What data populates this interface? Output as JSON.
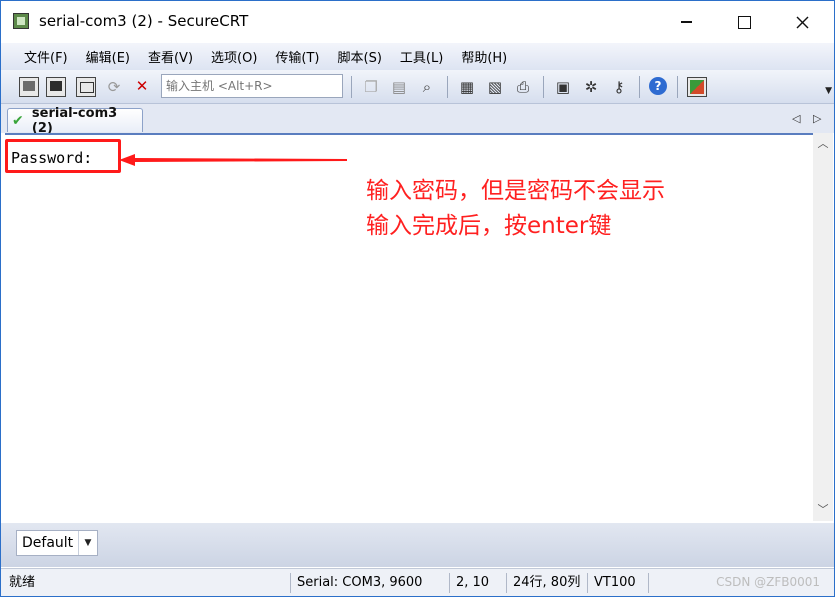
{
  "window": {
    "title": "serial-com3 (2) - SecureCRT",
    "controls": {
      "minimize": "minimize-icon",
      "maximize": "maximize-icon",
      "close": "close-icon"
    }
  },
  "menu": {
    "items": [
      "文件(F)",
      "编辑(E)",
      "查看(V)",
      "选项(O)",
      "传输(T)",
      "脚本(S)",
      "工具(L)",
      "帮助(H)"
    ]
  },
  "toolbar": {
    "host_placeholder": "输入主机 <Alt+R>",
    "icons": [
      "connect-icon",
      "quick-connect-icon",
      "connect-in-tab-icon",
      "reconnect-icon",
      "disconnect-icon",
      "copy-icon",
      "paste-icon",
      "find-icon",
      "print-icon",
      "print-setup-icon",
      "printer-icon",
      "session-options-icon",
      "global-options-icon",
      "key-icon",
      "help-icon",
      "sftp-icon"
    ]
  },
  "tabs": [
    {
      "label": "serial-com3 (2)",
      "icon": "check-icon"
    }
  ],
  "terminal": {
    "lines": [
      "Password:"
    ]
  },
  "annotation": {
    "line1": "输入密码，但是密码不会显示",
    "line2": "输入完成后，按enter键",
    "color": "#ff2020"
  },
  "session": {
    "selected": "Default"
  },
  "status": {
    "state": "就绪",
    "connection": "Serial: COM3, 9600",
    "cursor": "2, 10",
    "size": "24行, 80列",
    "emulation": "VT100",
    "watermark": "CSDN @ZFB0001"
  },
  "colors": {
    "accent_border": "#2b6fc9",
    "annotation_red": "#ff1a1a"
  }
}
